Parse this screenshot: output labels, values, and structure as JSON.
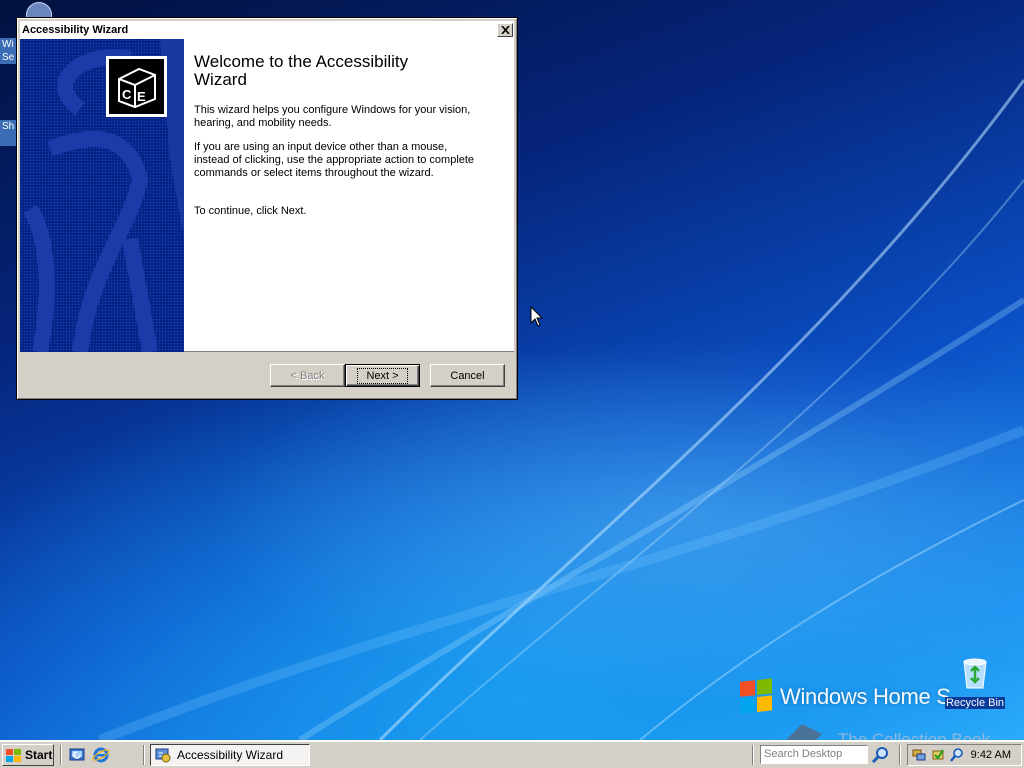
{
  "window": {
    "title": "Accessibility Wizard",
    "heading": "Welcome to the Accessibility Wizard",
    "paragraph1": "This wizard helps you configure Windows for your vision, hearing, and mobility needs.",
    "paragraph2": "If you are using an input device other than a mouse, instead of clicking, use the appropriate action to complete commands or select items throughout the wizard.",
    "paragraph3": "To continue, click Next.",
    "back_label": "< Back",
    "next_label": "Next >",
    "cancel_label": "Cancel"
  },
  "desktop": {
    "left_icon1_text": "Wi Se",
    "left_icon2_text": "Sh",
    "brand_text": "Windows Home Se",
    "recycle_label": "Recycle Bin",
    "watermark": "The Collection Book"
  },
  "taskbar": {
    "start_label": "Start",
    "task_label": "Accessibility Wizard",
    "search_placeholder": "Search Desktop",
    "clock": "9:42 AM"
  },
  "icons": {
    "start": "windows-flag-icon",
    "quicklaunch": [
      "show-desktop-icon",
      "internet-explorer-icon"
    ],
    "tray": [
      "network-icon",
      "security-icon",
      "search-icon"
    ]
  },
  "colors": {
    "window_face": "#d4d0c8",
    "side_panel": "#001b7a",
    "desktop_blue": "#0a4fc4"
  }
}
